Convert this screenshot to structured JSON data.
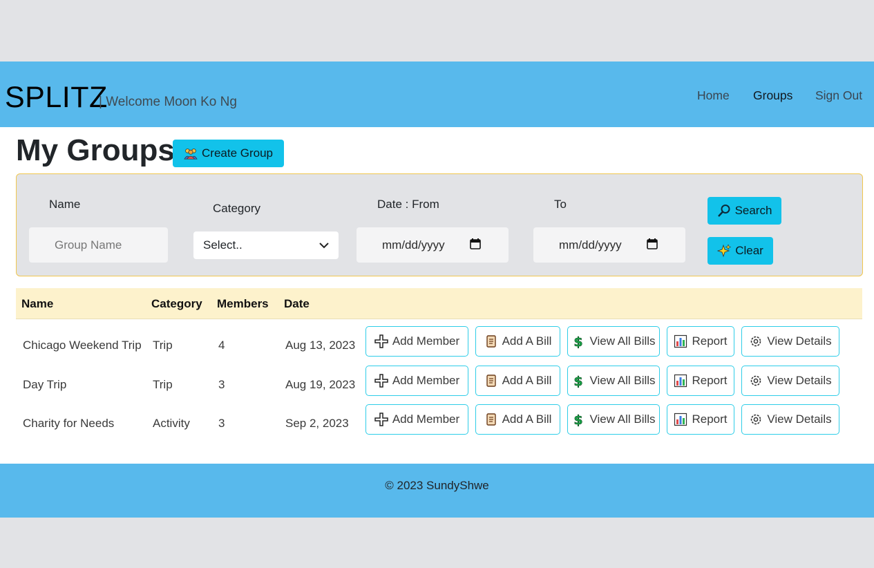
{
  "navbar": {
    "brand": "SPLITZ",
    "welcome": "| Welcome Moon Ko Ng",
    "links": [
      {
        "label": "Home"
      },
      {
        "label": "Groups"
      },
      {
        "label": "Sign Out"
      }
    ]
  },
  "page": {
    "title": "My Groups",
    "create_label": "Create Group"
  },
  "filters": {
    "name_label": "Name",
    "name_placeholder": "Group Name",
    "category_label": "Category",
    "category_value": "Select..",
    "date_from_label": "Date : From",
    "date_from_value": "mm/dd/yyyy",
    "date_to_label": "To",
    "date_to_value": "mm/dd/yyyy",
    "search_label": "Search",
    "clear_label": "Clear"
  },
  "table": {
    "headers": [
      "Name",
      "Category",
      "Members",
      "Date"
    ],
    "action_labels": {
      "add_member": "Add Member",
      "add_bill": "Add A Bill",
      "view_bills": "View All Bills",
      "report": "Report",
      "view_details": "View Details"
    },
    "rows": [
      {
        "name": "Chicago Weekend Trip",
        "category": "Trip",
        "members": "4",
        "date": "Aug 13, 2023"
      },
      {
        "name": "Day Trip",
        "category": "Trip",
        "members": "3",
        "date": "Aug 19, 2023"
      },
      {
        "name": "Charity for Needs",
        "category": "Activity",
        "members": "3",
        "date": "Sep 2, 2023"
      }
    ]
  },
  "footer": {
    "copyright": "© 2023 SundyShwe"
  },
  "colors": {
    "navbar": "#58b9ec",
    "button": "#12c2ea",
    "table_header": "#fdf2cc",
    "filter_border": "#f0c64d"
  }
}
